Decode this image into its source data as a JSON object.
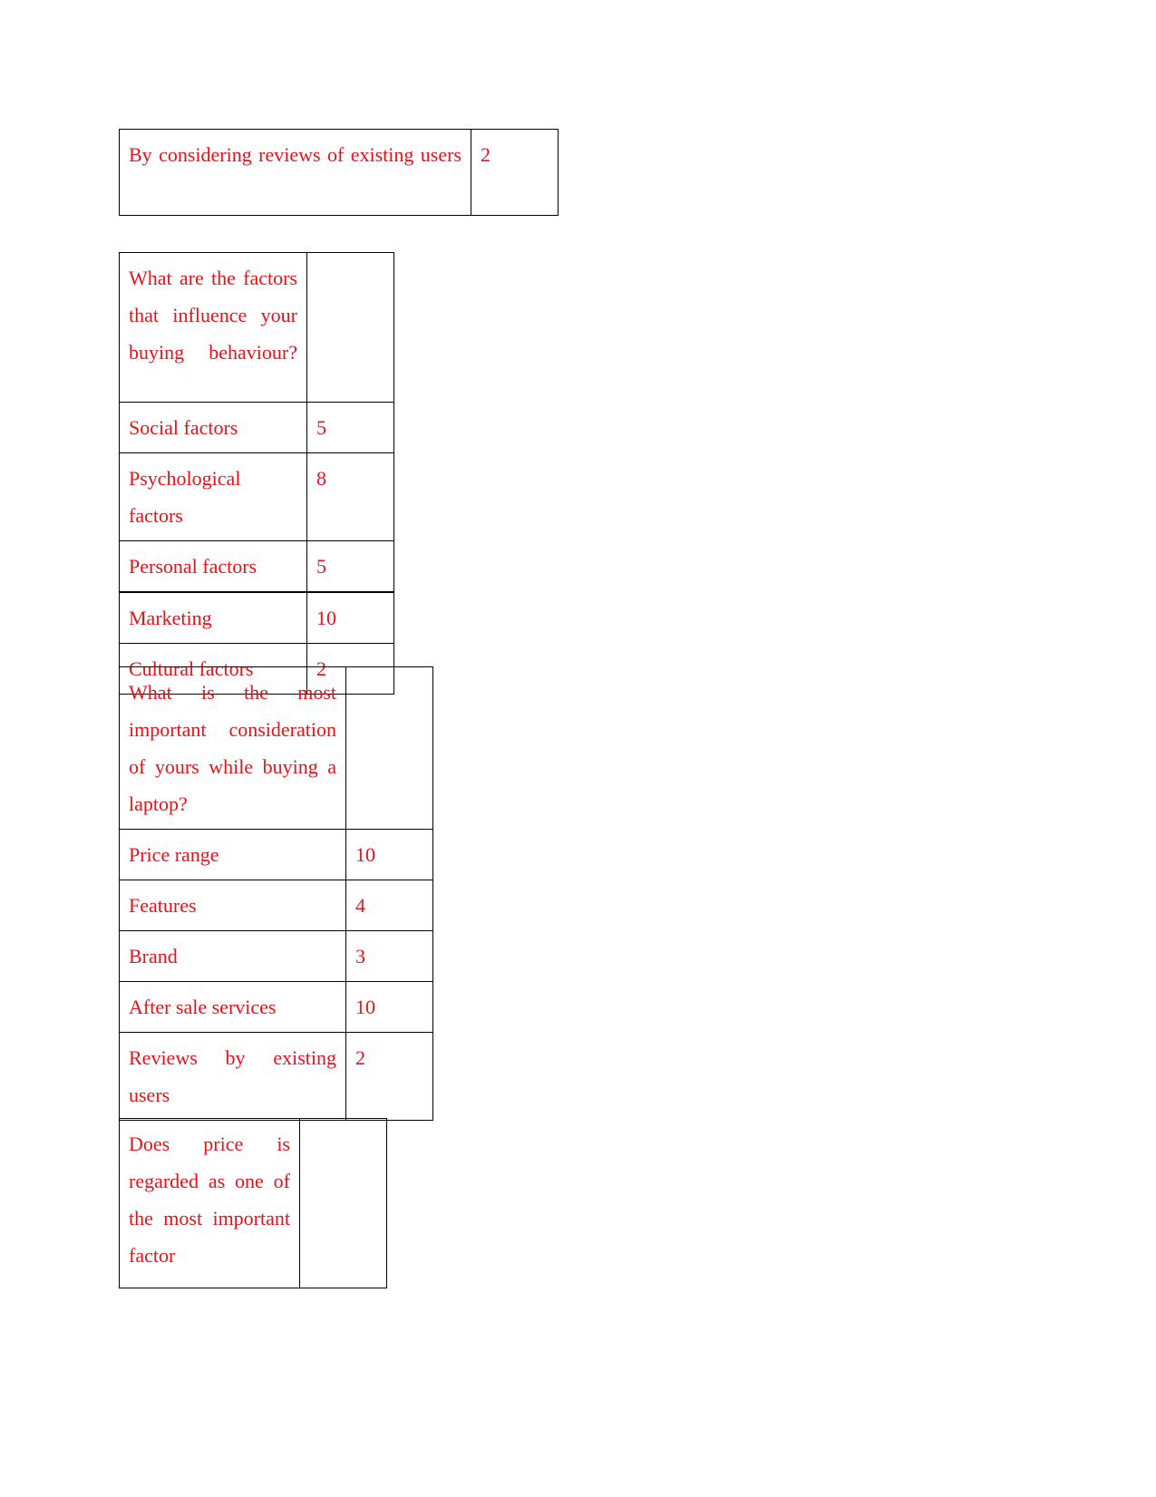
{
  "text_color": "#e8111a",
  "border_color": "#000000",
  "tables": [
    {
      "rows": [
        {
          "label": "By considering reviews of existing users",
          "value": "2"
        }
      ]
    },
    {
      "header": "What are the factors that influence your buying behaviour?",
      "header_value": "",
      "rows": [
        {
          "label": "Social factors",
          "value": "5"
        },
        {
          "label": "Psychological factors",
          "value": "8"
        },
        {
          "label": "Personal factors",
          "value": "5"
        },
        {
          "label": "Marketing",
          "value": "10"
        },
        {
          "label": "Cultural factors",
          "value": "2"
        }
      ]
    },
    {
      "header": "What is the most important consideration of yours while buying a laptop?",
      "header_value": "",
      "rows": [
        {
          "label": "Price range",
          "value": "10"
        },
        {
          "label": "Features",
          "value": "4"
        },
        {
          "label": "Brand",
          "value": "3"
        },
        {
          "label": "After sale services",
          "value": "10"
        },
        {
          "label": "Reviews by existing users",
          "value": "2"
        }
      ]
    },
    {
      "header": "Does price is regarded as one of the most important factor",
      "header_value": ""
    }
  ]
}
